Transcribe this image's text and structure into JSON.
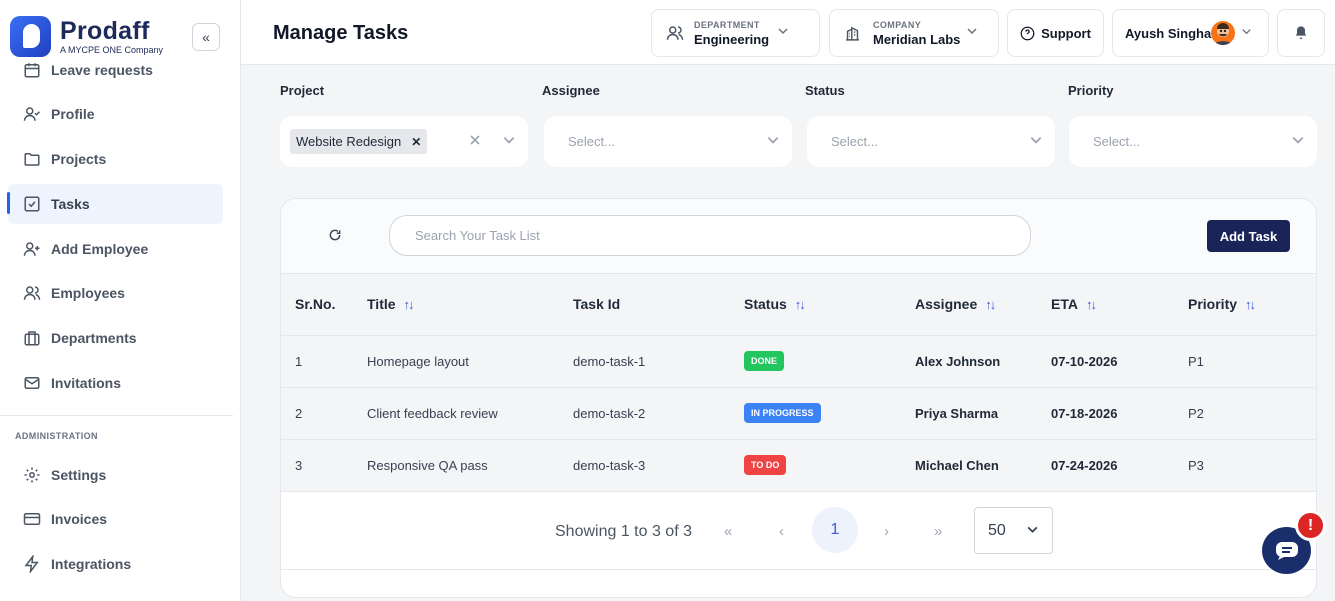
{
  "brand": {
    "name": "Prodaff",
    "tagline": "A MYCPE ONE Company"
  },
  "sidebar": {
    "items": [
      {
        "label": "Leave requests",
        "icon": "calendar-icon"
      },
      {
        "label": "Profile",
        "icon": "user-check-icon"
      },
      {
        "label": "Projects",
        "icon": "folder-icon"
      },
      {
        "label": "Tasks",
        "icon": "checkbox-icon",
        "active": true
      },
      {
        "label": "Add Employee",
        "icon": "user-plus-icon"
      },
      {
        "label": "Employees",
        "icon": "users-icon"
      },
      {
        "label": "Departments",
        "icon": "briefcase-icon"
      },
      {
        "label": "Invitations",
        "icon": "mail-icon"
      }
    ],
    "admin_label": "ADMINISTRATION",
    "admin_items": [
      {
        "label": "Settings",
        "icon": "gear-icon"
      },
      {
        "label": "Invoices",
        "icon": "credit-card-icon"
      },
      {
        "label": "Integrations",
        "icon": "lightning-icon"
      }
    ]
  },
  "header": {
    "title": "Manage Tasks",
    "department_label": "DEPARTMENT",
    "department_value": "Engineering",
    "company_label": "COMPANY",
    "company_value": "Meridian Labs",
    "support_label": "Support",
    "user_name": "Ayush Singhal"
  },
  "filters": {
    "project_label": "Project",
    "project_chip": "Website Redesign",
    "assignee_label": "Assignee",
    "assignee_placeholder": "Select...",
    "status_label": "Status",
    "status_placeholder": "Select...",
    "priority_label": "Priority",
    "priority_placeholder": "Select..."
  },
  "toolbar": {
    "search_placeholder": "Search Your Task List",
    "add_task_label": "Add Task"
  },
  "table": {
    "columns": [
      "Sr.No.",
      "Title",
      "Task Id",
      "Status",
      "Assignee",
      "ETA",
      "Priority"
    ],
    "rows": [
      {
        "sr": "1",
        "title": "Homepage layout",
        "task_id": "demo-task-1",
        "status": "DONE",
        "status_color": "#22c55e",
        "assignee": "Alex Johnson",
        "eta": "07-10-2026",
        "priority": "P1"
      },
      {
        "sr": "2",
        "title": "Client feedback review",
        "task_id": "demo-task-2",
        "status": "IN PROGRESS",
        "status_color": "#3b82f6",
        "assignee": "Priya Sharma",
        "eta": "07-18-2026",
        "priority": "P2"
      },
      {
        "sr": "3",
        "title": "Responsive QA pass",
        "task_id": "demo-task-3",
        "status": "TO DO",
        "status_color": "#ef4444",
        "assignee": "Michael Chen",
        "eta": "07-24-2026",
        "priority": "P3"
      }
    ]
  },
  "pagination": {
    "showing": "Showing 1 to 3 of 3",
    "first": "«",
    "prev": "‹",
    "current": "1",
    "next": "›",
    "last": "»",
    "page_size": "50"
  },
  "chat": {
    "alert": "!"
  }
}
